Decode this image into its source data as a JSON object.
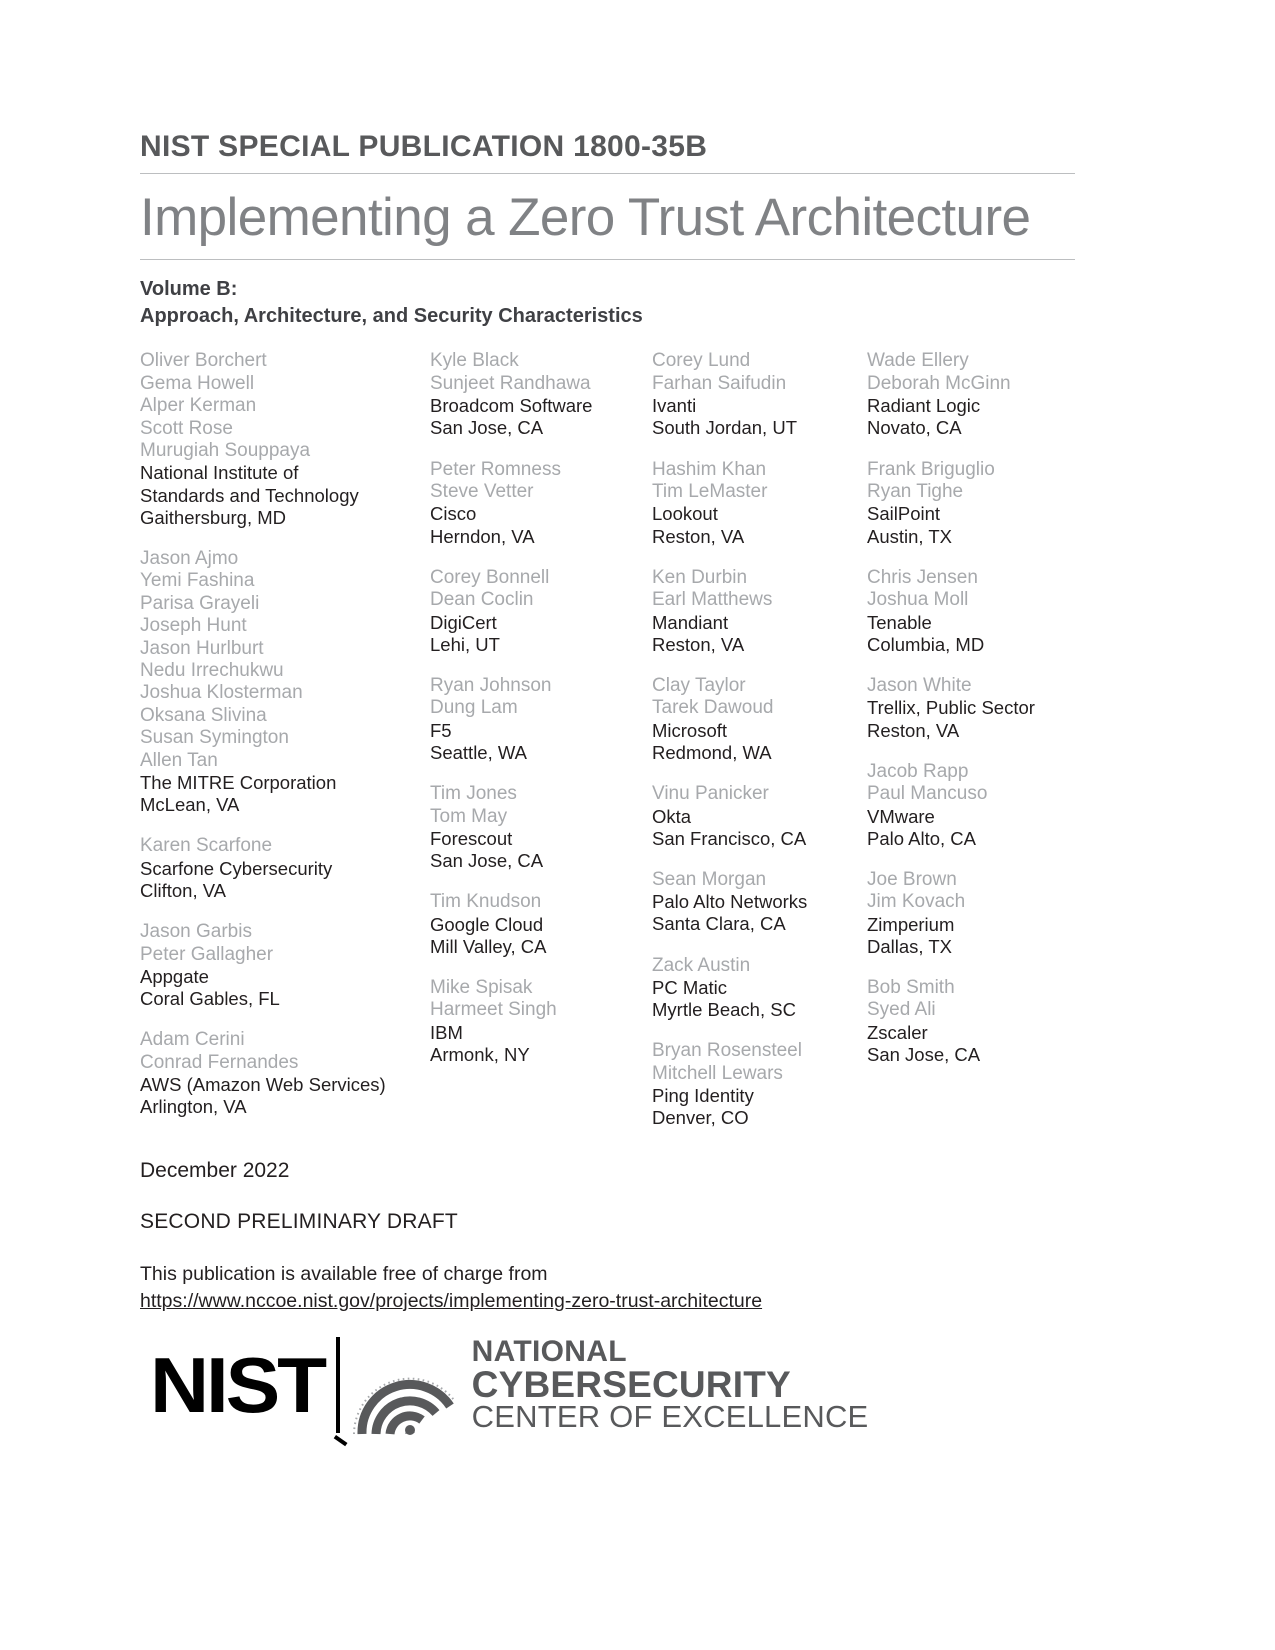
{
  "header": {
    "publication_number": "NIST SPECIAL PUBLICATION 1800-35B",
    "title": "Implementing a Zero Trust Architecture",
    "volume": "Volume B:",
    "volume_subtitle": "Approach, Architecture, and Security Characteristics"
  },
  "contributors": {
    "columns": [
      {
        "groups": [
          {
            "people": [
              "Oliver Borchert",
              "Gema Howell",
              "Alper Kerman",
              "Scott Rose",
              "Murugiah Souppaya"
            ],
            "org_lines": [
              "National Institute of",
              "Standards and Technology"
            ],
            "location": "Gaithersburg, MD"
          },
          {
            "people": [
              "Jason Ajmo",
              "Yemi Fashina",
              "Parisa Grayeli",
              "Joseph Hunt",
              "Jason Hurlburt",
              "Nedu Irrechukwu",
              "Joshua Klosterman",
              "Oksana Slivina",
              "Susan Symington",
              "Allen Tan"
            ],
            "org_lines": [
              "The MITRE Corporation"
            ],
            "location": "McLean, VA"
          },
          {
            "people": [
              "Karen Scarfone"
            ],
            "org_lines": [
              "Scarfone Cybersecurity"
            ],
            "location": "Clifton, VA"
          },
          {
            "people": [
              "Jason Garbis",
              "Peter Gallagher"
            ],
            "org_lines": [
              "Appgate"
            ],
            "location": "Coral Gables, FL"
          },
          {
            "people": [
              "Adam Cerini",
              "Conrad Fernandes"
            ],
            "org_lines": [
              "AWS (Amazon Web Services)"
            ],
            "location": "Arlington, VA"
          }
        ]
      },
      {
        "groups": [
          {
            "people": [
              "Kyle Black",
              "Sunjeet Randhawa"
            ],
            "org_lines": [
              "Broadcom Software"
            ],
            "location": "San Jose, CA"
          },
          {
            "people": [
              "Peter Romness",
              "Steve Vetter"
            ],
            "org_lines": [
              "Cisco"
            ],
            "location": "Herndon, VA"
          },
          {
            "people": [
              "Corey Bonnell",
              "Dean Coclin"
            ],
            "org_lines": [
              "DigiCert"
            ],
            "location": "Lehi, UT"
          },
          {
            "people": [
              "Ryan Johnson",
              "Dung Lam"
            ],
            "org_lines": [
              "F5"
            ],
            "location": "Seattle, WA"
          },
          {
            "people": [
              "Tim Jones",
              "Tom May"
            ],
            "org_lines": [
              "Forescout"
            ],
            "location": "San Jose, CA"
          },
          {
            "people": [
              "Tim Knudson"
            ],
            "org_lines": [
              "Google Cloud"
            ],
            "location": "Mill Valley, CA"
          },
          {
            "people": [
              "Mike Spisak",
              "Harmeet Singh"
            ],
            "org_lines": [
              "IBM"
            ],
            "location": "Armonk, NY"
          }
        ]
      },
      {
        "groups": [
          {
            "people": [
              "Corey Lund",
              "Farhan Saifudin"
            ],
            "org_lines": [
              "Ivanti"
            ],
            "location": "South Jordan, UT"
          },
          {
            "people": [
              "Hashim Khan",
              "Tim LeMaster"
            ],
            "org_lines": [
              "Lookout"
            ],
            "location": "Reston, VA"
          },
          {
            "people": [
              "Ken Durbin",
              "Earl Matthews"
            ],
            "org_lines": [
              "Mandiant"
            ],
            "location": "Reston, VA"
          },
          {
            "people": [
              "Clay Taylor",
              "Tarek Dawoud"
            ],
            "org_lines": [
              "Microsoft"
            ],
            "location": "Redmond, WA"
          },
          {
            "people": [
              "Vinu Panicker"
            ],
            "org_lines": [
              "Okta"
            ],
            "location": "San Francisco, CA"
          },
          {
            "people": [
              "Sean Morgan"
            ],
            "org_lines": [
              "Palo Alto Networks"
            ],
            "location": "Santa Clara, CA"
          },
          {
            "people": [
              "Zack Austin"
            ],
            "org_lines": [
              "PC Matic"
            ],
            "location": "Myrtle Beach, SC"
          },
          {
            "people": [
              "Bryan Rosensteel",
              "Mitchell Lewars"
            ],
            "org_lines": [
              "Ping Identity"
            ],
            "location": "Denver, CO"
          }
        ]
      },
      {
        "groups": [
          {
            "people": [
              "Wade Ellery",
              "Deborah McGinn"
            ],
            "org_lines": [
              "Radiant Logic"
            ],
            "location": "Novato, CA"
          },
          {
            "people": [
              "Frank Briguglio",
              "Ryan Tighe"
            ],
            "org_lines": [
              "SailPoint"
            ],
            "location": "Austin, TX"
          },
          {
            "people": [
              "Chris Jensen",
              "Joshua Moll"
            ],
            "org_lines": [
              "Tenable"
            ],
            "location": "Columbia, MD"
          },
          {
            "people": [
              "Jason White"
            ],
            "org_lines": [
              "Trellix, Public Sector"
            ],
            "location": "Reston, VA"
          },
          {
            "people": [
              "Jacob Rapp",
              "Paul Mancuso"
            ],
            "org_lines": [
              "VMware"
            ],
            "location": "Palo Alto, CA"
          },
          {
            "people": [
              "Joe Brown",
              "Jim Kovach"
            ],
            "org_lines": [
              "Zimperium"
            ],
            "location": "Dallas, TX"
          },
          {
            "people": [
              "Bob Smith",
              "Syed Ali"
            ],
            "org_lines": [
              "Zscaler"
            ],
            "location": "San Jose, CA"
          }
        ]
      }
    ]
  },
  "footer": {
    "date": "December 2022",
    "draft_status": "SECOND PRELIMINARY DRAFT",
    "availability_text": "This publication is available free of charge from",
    "availability_url": "https://www.nccoe.nist.gov/projects/implementing-zero-trust-architecture"
  },
  "logo": {
    "nist_wordmark": "NIST",
    "nccoe_line1": "NATIONAL",
    "nccoe_line2": "CYBERSECURITY",
    "nccoe_line3": "CENTER OF EXCELLENCE"
  },
  "colors": {
    "title_gray": "#808285",
    "pub_number_gray": "#58595b",
    "person_gray": "#a7a9ac",
    "body_black": "#231f20",
    "rule_gray": "#bcbec0"
  }
}
